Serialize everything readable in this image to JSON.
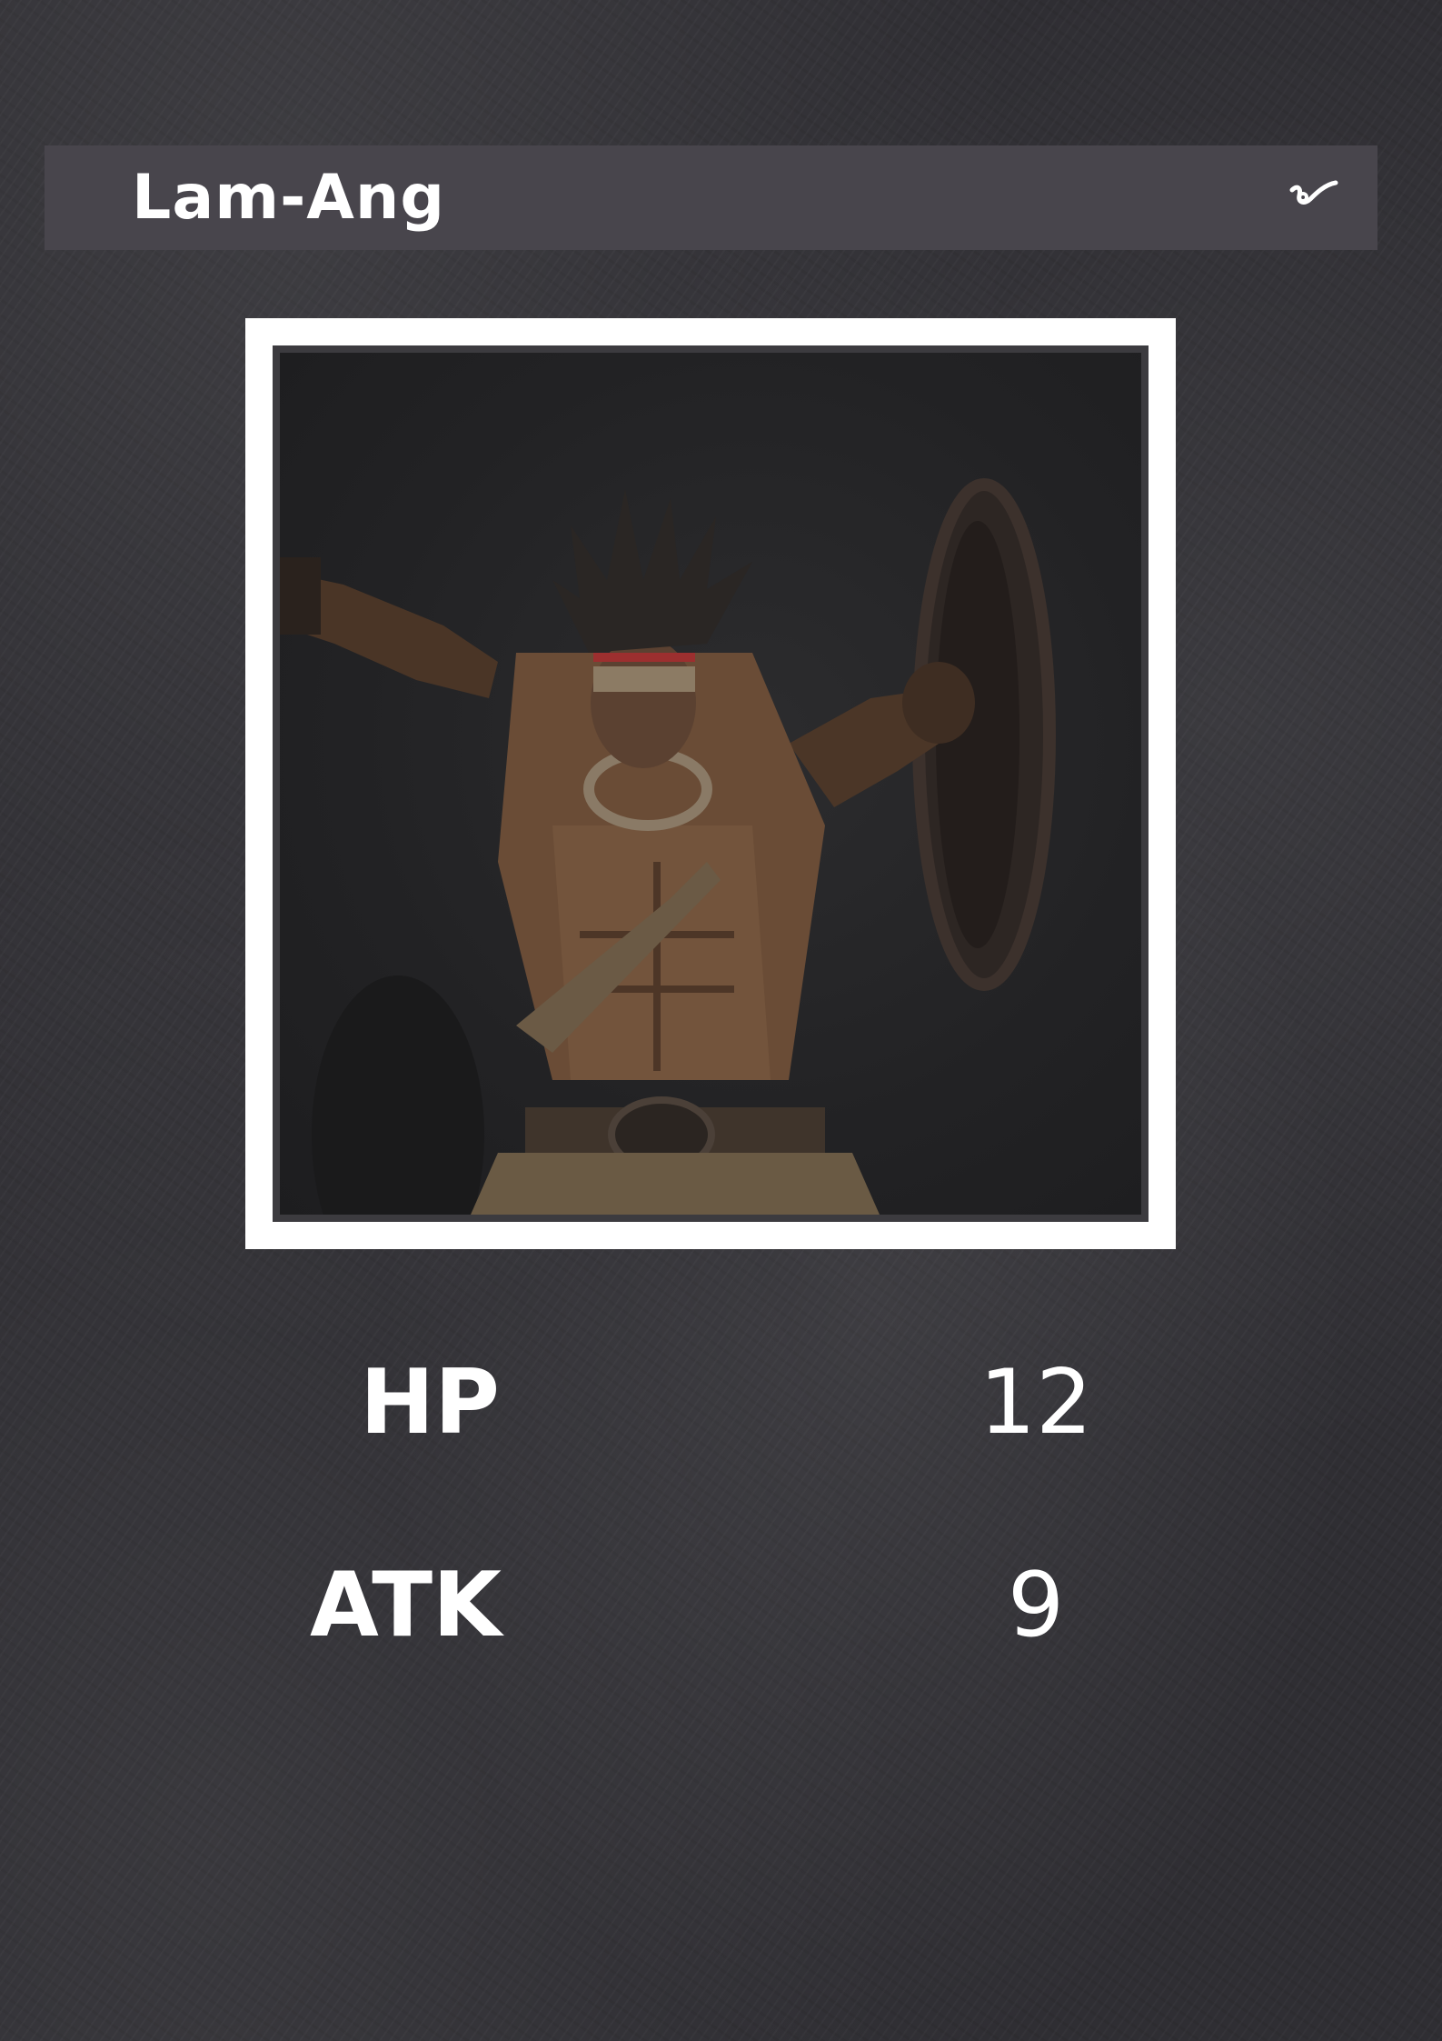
{
  "card": {
    "name": "Lam-Ang",
    "type_icon": "signature-flourish-icon",
    "portrait": "warrior-portrait",
    "stats": {
      "hp_label": "HP",
      "hp_value": "12",
      "atk_label": "ATK",
      "atk_value": "9"
    }
  },
  "colors": {
    "background": "#2f2e33",
    "name_bar": "#48454c",
    "frame": "#ffffff",
    "text": "#ffffff"
  }
}
